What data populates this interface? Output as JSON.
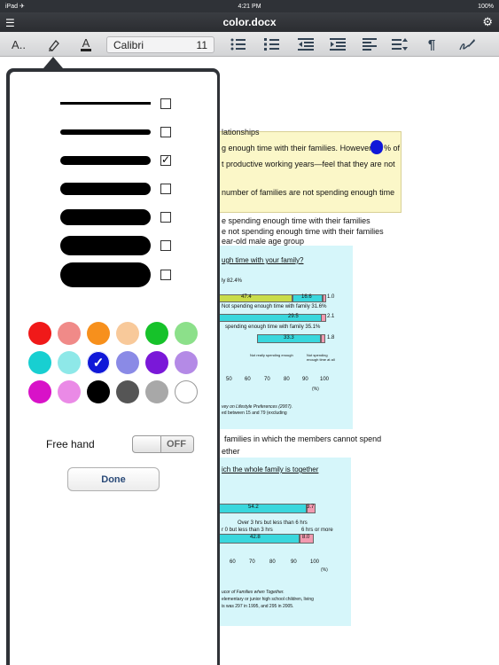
{
  "status_bar": {
    "left": "iPad ✈",
    "time": "4:21 PM",
    "battery": "100%"
  },
  "titlebar": {
    "title": "color.docx",
    "menu_icon": "menu-icon",
    "gear_icon": "gear-icon"
  },
  "toolbar": {
    "text_style": "A..",
    "font_color_letter": "A",
    "font_name": "Calibri",
    "font_size": "11",
    "paragraph_mark": "¶"
  },
  "popover": {
    "free_hand_label": "Free hand",
    "toggle_label": "OFF",
    "done_label": "Done",
    "strokes": [
      {
        "checked": false
      },
      {
        "checked": false
      },
      {
        "checked": true
      },
      {
        "checked": false
      },
      {
        "checked": false
      },
      {
        "checked": false
      },
      {
        "checked": false
      }
    ],
    "colors": [
      "#f01919",
      "#f08a88",
      "#f7901c",
      "#f8c99a",
      "#16c22a",
      "#8ce08a",
      "#18cfd1",
      "#8ee8e8",
      "#1018d8",
      "#8a8ae6",
      "#7a18d8",
      "#b48ae6",
      "#d812c8",
      "#ea8ae6",
      "#000000",
      "#555555",
      "#a8a8a8",
      "#ffffff"
    ],
    "selected_color": "#1018d8"
  },
  "document": {
    "lines": [
      "lationships",
      "g enough time with their families. However,",
      "% of",
      "t productive working years—feel that they are not",
      "number of families are not spending enough time",
      "e spending enough time with their families",
      "e not spending enough time with their families",
      "ear-old male age group",
      "ugh time with your family?",
      "ly  82.4%",
      "47.4",
      "16.6",
      "1.0",
      "Not spending enough time with family  31.6%",
      "29.5",
      "2.1",
      "spending enough time with family  35.1%",
      "33.3",
      "1.8",
      "Not really spending enough",
      "Not spending enough time at all",
      "50",
      "60",
      "70",
      "80",
      "90",
      "100",
      "(%)",
      "vey on Lifestyle Preferences (2007).",
      "ed between 15 and 79 (excluding",
      "families in which the members cannot spend",
      "ether",
      "ich the whole family is together",
      "54.2",
      "3.7",
      "Over 3 hrs but less than 6 hrs",
      "r 0 but less than 3 hrs",
      "6 hrs or more",
      "42.8",
      "8.0",
      "60",
      "70",
      "80",
      "90",
      "100",
      "(%)",
      "ucor of Families when Together.",
      "elementary or junior high school children, living",
      "is was 297 in 1995, and 295 in 2005."
    ]
  }
}
